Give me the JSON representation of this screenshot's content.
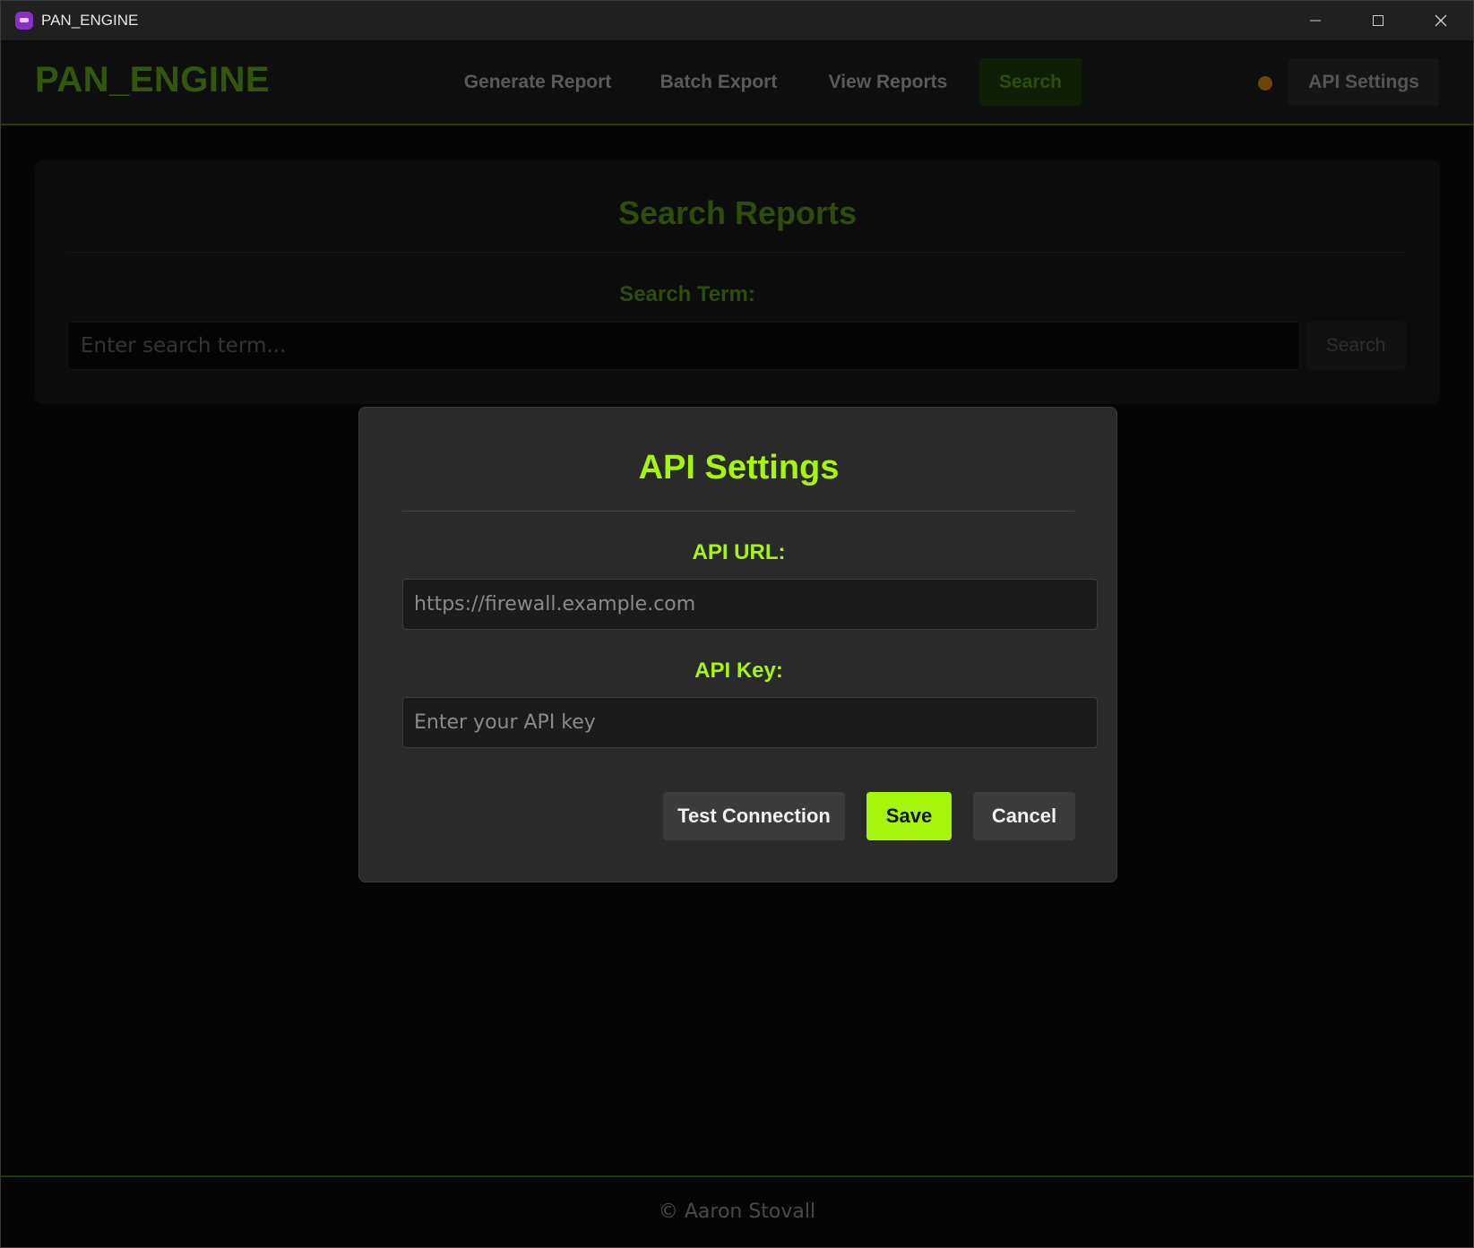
{
  "window": {
    "title": "PAN_ENGINE",
    "controls": {
      "minimize": "minimize",
      "maximize": "maximize",
      "close": "close"
    }
  },
  "header": {
    "logo": "PAN_ENGINE",
    "nav": [
      {
        "label": "Generate Report",
        "active": false
      },
      {
        "label": "Batch Export",
        "active": false
      },
      {
        "label": "View Reports",
        "active": false
      },
      {
        "label": "Search",
        "active": true
      }
    ],
    "connection_status_color": "#c77c00",
    "api_settings_label": "API Settings"
  },
  "search_card": {
    "title": "Search Reports",
    "search_term_label": "Search Term:",
    "search_placeholder": "Enter search term...",
    "search_button": "Search"
  },
  "modal": {
    "title": "API Settings",
    "api_url_label": "API URL:",
    "api_url_placeholder": "https://firewall.example.com",
    "api_key_label": "API Key:",
    "api_key_placeholder": "Enter your API key",
    "buttons": {
      "test": "Test Connection",
      "save": "Save",
      "cancel": "Cancel"
    }
  },
  "footer": {
    "text": "© Aaron Stovall"
  },
  "colors": {
    "accent": "#a6f50a",
    "modal_bg": "#2a2a2a",
    "page_bg": "#050505"
  }
}
